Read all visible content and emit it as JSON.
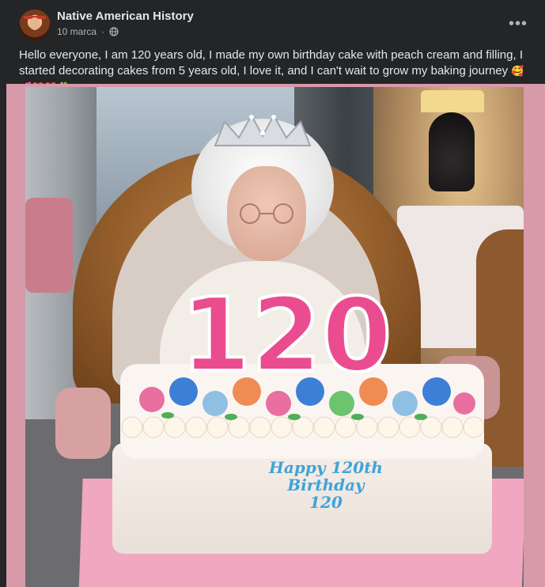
{
  "post": {
    "page_name": "Native American History",
    "timestamp": "10 marca",
    "separator": "·",
    "privacy_icon": "globe-icon",
    "more_label": "•••",
    "caption": "Hello everyone, I am 120 years old, I made my own birthday cake with peach cream and filling, I started decorating cakes from 5 years old, I love it, and I can't wait to grow my baking journey",
    "caption_emojis": "🥰💕❤️❤️🍀"
  },
  "image": {
    "candle_number": "120",
    "cake_text_lines": [
      "Happy 120th",
      "Birthday",
      "120"
    ]
  },
  "colors": {
    "background": "#242526",
    "primary_text": "#e4e6eb",
    "secondary_text": "#b0b3b8",
    "image_border": "#d69aa8",
    "candle_pink": "#ea4c8f",
    "cake_text_blue": "#3da4d9"
  }
}
